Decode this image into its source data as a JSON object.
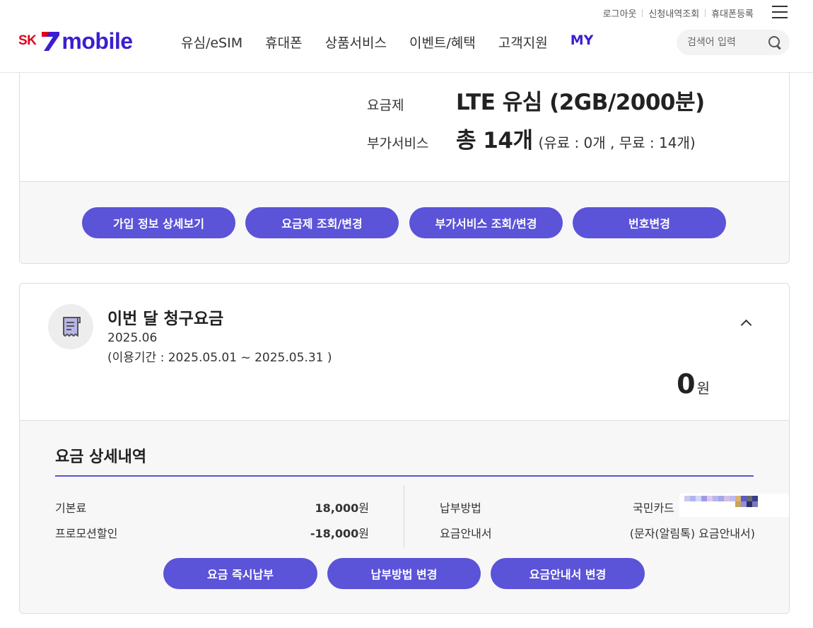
{
  "header": {
    "util_links": [
      "로그아웃",
      "신청내역조회",
      "휴대폰등록"
    ],
    "logo": {
      "sk": "SK",
      "seven": "7",
      "mobile": "mobile"
    },
    "nav": [
      "유심/eSIM",
      "휴대폰",
      "상품서비스",
      "이벤트/혜택",
      "고객지원"
    ],
    "nav_my": "MY",
    "search_placeholder": "검색어 입력"
  },
  "plan": {
    "plan_label": "요금제",
    "plan_value": "LTE 유심 (2GB/2000분)",
    "addon_label": "부가서비스",
    "addon_value": "총 14개",
    "addon_detail": "(유료 : 0개 , 무료 : 14개)",
    "buttons": [
      "가입 정보 상세보기",
      "요금제 조회/변경",
      "부가서비스 조회/변경",
      "번호변경"
    ]
  },
  "bill": {
    "title": "이번 달 청구요금",
    "month": "2025.06",
    "period": "(이용기간 : 2025.05.01 ~ 2025.05.31 )",
    "amount": "0",
    "amount_unit": "원",
    "detail_title": "요금 상세내역",
    "left_rows": [
      {
        "label": "기본료",
        "value": "18,000",
        "unit": "원"
      },
      {
        "label": "프로모션할인",
        "value": "-18,000",
        "unit": "원"
      }
    ],
    "right_rows": [
      {
        "label": "납부방법",
        "value": "국민카드"
      },
      {
        "label": "요금안내서",
        "value": "(문자(알림톡) 요금안내서)"
      }
    ],
    "buttons": [
      "요금 즉시납부",
      "납부방법 변경",
      "요금안내서 변경"
    ]
  },
  "colors": {
    "brand_purple": "#5b53d8",
    "logo_blue": "#3a1fd1",
    "sk_red": "#e2001a"
  }
}
